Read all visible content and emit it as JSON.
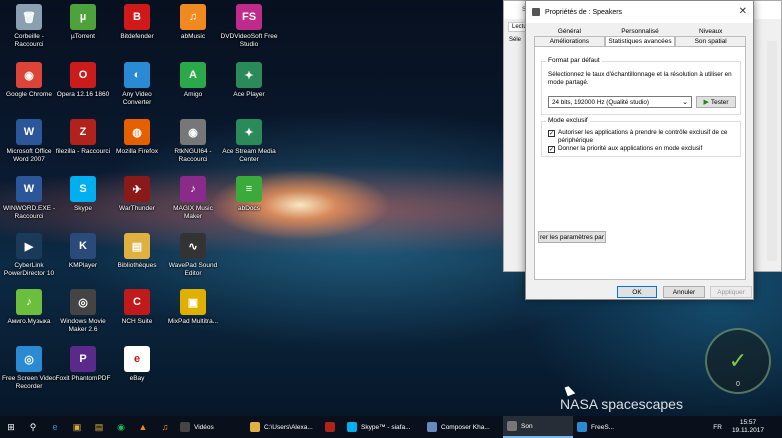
{
  "desktop_icons": [
    {
      "label": "Corbeille - Raccourci",
      "icon": "recycle-bin-icon",
      "color": "#8aa0b0",
      "glyph": "🗑"
    },
    {
      "label": "Google Chrome",
      "icon": "chrome-icon",
      "color": "#db4437",
      "glyph": "◉"
    },
    {
      "label": "Microsoft Office Word 2007",
      "icon": "word-icon",
      "color": "#2b579a",
      "glyph": "W"
    },
    {
      "label": "WINWORD.EXE - Raccourci",
      "icon": "word-shortcut-icon",
      "color": "#2b579a",
      "glyph": "W"
    },
    {
      "label": "CyberLink PowerDirector 10",
      "icon": "powerdirector-icon",
      "color": "#1a3a5a",
      "glyph": "▶"
    },
    {
      "label": "Амиго.Музыка",
      "icon": "amigo-music-icon",
      "color": "#6cbf3c",
      "glyph": "♪"
    },
    {
      "label": "Free Screen Video Recorder",
      "icon": "screen-recorder-icon",
      "color": "#2a8ad4",
      "glyph": "◎"
    },
    {
      "label": "µTorrent",
      "icon": "utorrent-icon",
      "color": "#4ea23c",
      "glyph": "µ"
    },
    {
      "label": "Opera 12.16 1860",
      "icon": "opera-icon",
      "color": "#cc1b1b",
      "glyph": "O"
    },
    {
      "label": "filezilla - Raccourci",
      "icon": "filezilla-icon",
      "color": "#b0221b",
      "glyph": "Z"
    },
    {
      "label": "Skype",
      "icon": "skype-icon",
      "color": "#00aff0",
      "glyph": "S"
    },
    {
      "label": "KMPlayer",
      "icon": "kmplayer-icon",
      "color": "#2a4a7a",
      "glyph": "K"
    },
    {
      "label": "Windows Movie Maker 2.6",
      "icon": "movie-maker-icon",
      "color": "#444",
      "glyph": "◎"
    },
    {
      "label": "Foxit PhantomPDF",
      "icon": "foxit-icon",
      "color": "#5a2a8a",
      "glyph": "P"
    },
    {
      "label": "Bitdefender",
      "icon": "bitdefender-icon",
      "color": "#d01a1a",
      "glyph": "B"
    },
    {
      "label": "Any Video Converter",
      "icon": "video-converter-icon",
      "color": "#2a8ad4",
      "glyph": "◐"
    },
    {
      "label": "Mozilla Firefox",
      "icon": "firefox-icon",
      "color": "#e66000",
      "glyph": "◍"
    },
    {
      "label": "WarThunder",
      "icon": "warthunder-icon",
      "color": "#8a1a1a",
      "glyph": "✈"
    },
    {
      "label": "Bibliothèques",
      "icon": "libraries-icon",
      "color": "#e0b040",
      "glyph": "▤"
    },
    {
      "label": "NCH Suite",
      "icon": "nch-icon",
      "color": "#c01a1a",
      "glyph": "C"
    },
    {
      "label": "eBay",
      "icon": "ebay-icon",
      "color": "#ffffff",
      "glyph": "e"
    },
    {
      "label": "abMusic",
      "icon": "abmusic-icon",
      "color": "#f08a20",
      "glyph": "♫"
    },
    {
      "label": "Amigo",
      "icon": "amigo-icon",
      "color": "#2aa84a",
      "glyph": "A"
    },
    {
      "label": "RtkNGUI64 - Raccourci",
      "icon": "speaker-icon",
      "color": "#777",
      "glyph": "◉"
    },
    {
      "label": "MAGIX Music Maker",
      "icon": "magix-icon",
      "color": "#8a2a8a",
      "glyph": "♪"
    },
    {
      "label": "WavePad Sound Editor",
      "icon": "wavepad-icon",
      "color": "#333",
      "glyph": "∿"
    },
    {
      "label": "MixPad Multitra...",
      "icon": "mixpad-icon",
      "color": "#e0b000",
      "glyph": "▣"
    },
    {
      "label": "DVDVideoSoft Free Studio",
      "icon": "dvdvideosoft-icon",
      "color": "#c02a8a",
      "glyph": "FS"
    },
    {
      "label": "Ace Player",
      "icon": "ace-player-icon",
      "color": "#2a8a5a",
      "glyph": "✦"
    },
    {
      "label": "Ace Stream Media Center",
      "icon": "ace-stream-icon",
      "color": "#2a8a5a",
      "glyph": "✦"
    },
    {
      "label": "abDocs",
      "icon": "abdocs-icon",
      "color": "#3aaa3a",
      "glyph": "≡"
    }
  ],
  "bg_window": {
    "title": "So",
    "tab": "Lectu",
    "inner": "Séle"
  },
  "dialog": {
    "title": "Propriétés de : Speakers",
    "close": "✕",
    "tabs_row1": [
      "Général",
      "Personnalisé",
      "Niveaux"
    ],
    "tabs_row2": [
      "Améliorations",
      "Statistiques avancées",
      "Son spatial"
    ],
    "active_tab": "Statistiques avancées",
    "format_group": {
      "legend": "Format par défaut",
      "description": "Sélectionnez le taux d'échantillonnage et la résolution à utiliser en mode partagé.",
      "selected_format": "24 bits, 192000 Hz (Qualité studio)",
      "test_button": "Tester"
    },
    "exclusive_group": {
      "legend": "Mode exclusif",
      "options": [
        {
          "label": "Autoriser les applications à prendre le contrôle exclusif de ce périphérique",
          "checked": true
        },
        {
          "label": "Donner la priorité aux applications en mode exclusif",
          "checked": true
        }
      ]
    },
    "restore_button": "rer les paramètres par",
    "ok_button": "OK",
    "cancel_button": "Annuler",
    "apply_button": "Appliquer"
  },
  "watermark": "NASA spacescapes",
  "gauge": {
    "value": "0"
  },
  "taskbar": {
    "apps": [
      {
        "label": "Vidéos",
        "color": "#444"
      },
      {
        "label": "C:\\Users\\Alexa...",
        "color": "#e0b040"
      },
      {
        "label": "",
        "color": "#b0221b"
      },
      {
        "label": "Skype™ - siafa...",
        "color": "#00aff0"
      },
      {
        "label": "Composer Kha...",
        "color": "#6a8abf"
      },
      {
        "label": "Son",
        "color": "#777"
      },
      {
        "label": "FreeS...",
        "color": "#2a8ad4"
      }
    ],
    "lang": "FR",
    "time": "15:57",
    "date": "19.11.2017"
  }
}
